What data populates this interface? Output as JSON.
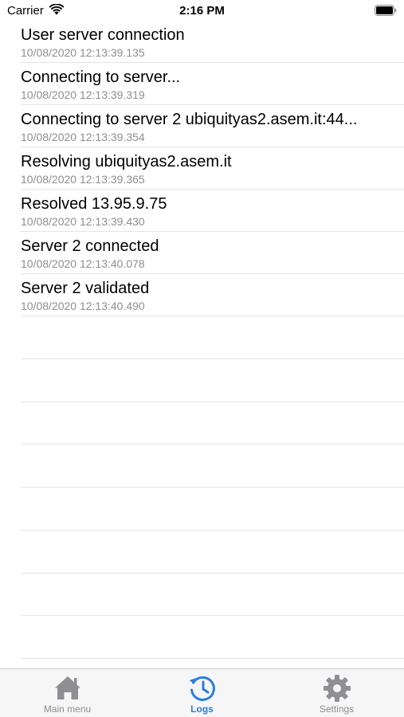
{
  "status_bar": {
    "carrier": "Carrier",
    "time": "2:16 PM",
    "wifi_icon": "wifi-icon",
    "battery_icon": "battery-full-icon"
  },
  "logs": [
    {
      "title": "User server connection",
      "timestamp": "10/08/2020 12:13:39.135"
    },
    {
      "title": "Connecting to server...",
      "timestamp": "10/08/2020 12:13:39.319"
    },
    {
      "title": "Connecting to server 2 ubiquityas2.asem.it:44...",
      "timestamp": "10/08/2020 12:13:39.354"
    },
    {
      "title": "Resolving ubiquityas2.asem.it",
      "timestamp": "10/08/2020 12:13:39.365"
    },
    {
      "title": "Resolved 13.95.9.75",
      "timestamp": "10/08/2020 12:13:39.430"
    },
    {
      "title": "Server 2 connected",
      "timestamp": "10/08/2020 12:13:40.078"
    },
    {
      "title": "Server 2 validated",
      "timestamp": "10/08/2020 12:13:40.490"
    }
  ],
  "tab_bar": {
    "tabs": [
      {
        "label": "Main menu",
        "icon": "home-icon",
        "active": false
      },
      {
        "label": "Logs",
        "icon": "history-clock-icon",
        "active": true
      },
      {
        "label": "Settings",
        "icon": "gear-icon",
        "active": false
      }
    ]
  },
  "colors": {
    "accent": "#2a7de1",
    "inactive": "#8e8e93",
    "separator": "#e4e4e6"
  }
}
